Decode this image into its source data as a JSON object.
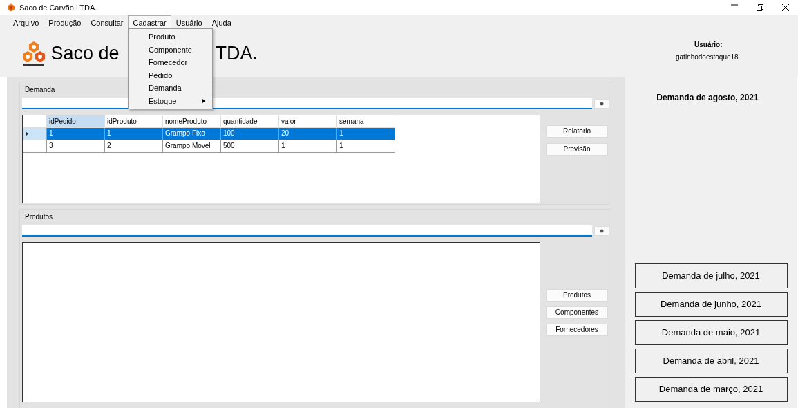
{
  "window": {
    "title": "Saco de Carvão LTDA."
  },
  "menu_bar": [
    {
      "label": "Arquivo",
      "open": false
    },
    {
      "label": "Produção",
      "open": false
    },
    {
      "label": "Consultar",
      "open": false
    },
    {
      "label": "Cadastrar",
      "open": true
    },
    {
      "label": "Usuário",
      "open": false
    },
    {
      "label": "Ajuda",
      "open": false
    }
  ],
  "dropdown": [
    {
      "label": "Produto",
      "submenu": false
    },
    {
      "label": "Componente",
      "submenu": false
    },
    {
      "label": "Fornecedor",
      "submenu": false
    },
    {
      "label": "Pedido",
      "submenu": false
    },
    {
      "label": "Demanda",
      "submenu": false
    },
    {
      "label": "Estoque",
      "submenu": true
    }
  ],
  "header": {
    "title_left": "Saco de",
    "title_right": "TDA.",
    "user_label": "Usuário:",
    "user_name": "gatinhodoestoque18"
  },
  "demanda": {
    "title": "Demanda",
    "table": {
      "columns": [
        "idPedido",
        "idProduto",
        "nomeProduto",
        "quantidade",
        "valor",
        "semana"
      ],
      "rows": [
        {
          "selected": true,
          "cells": [
            "1",
            "1",
            "Grampo Fixo",
            "100",
            "20",
            "1"
          ]
        },
        {
          "selected": false,
          "cells": [
            "3",
            "2",
            "Grampo Movel",
            "500",
            "1",
            "1"
          ]
        }
      ]
    },
    "buttons": [
      "Relatorio",
      "Previsão"
    ]
  },
  "produtos": {
    "title": "Produtos",
    "buttons": [
      "Produtos",
      "Componentes",
      "Fornecedores"
    ]
  },
  "side_panel": {
    "heading": "Demanda de agosto, 2021",
    "months": [
      "Demanda de julho, 2021",
      "Demanda de junho, 2021",
      "Demanda de maio, 2021",
      "Demanda de abril, 2021",
      "Demanda de março, 2021"
    ]
  }
}
